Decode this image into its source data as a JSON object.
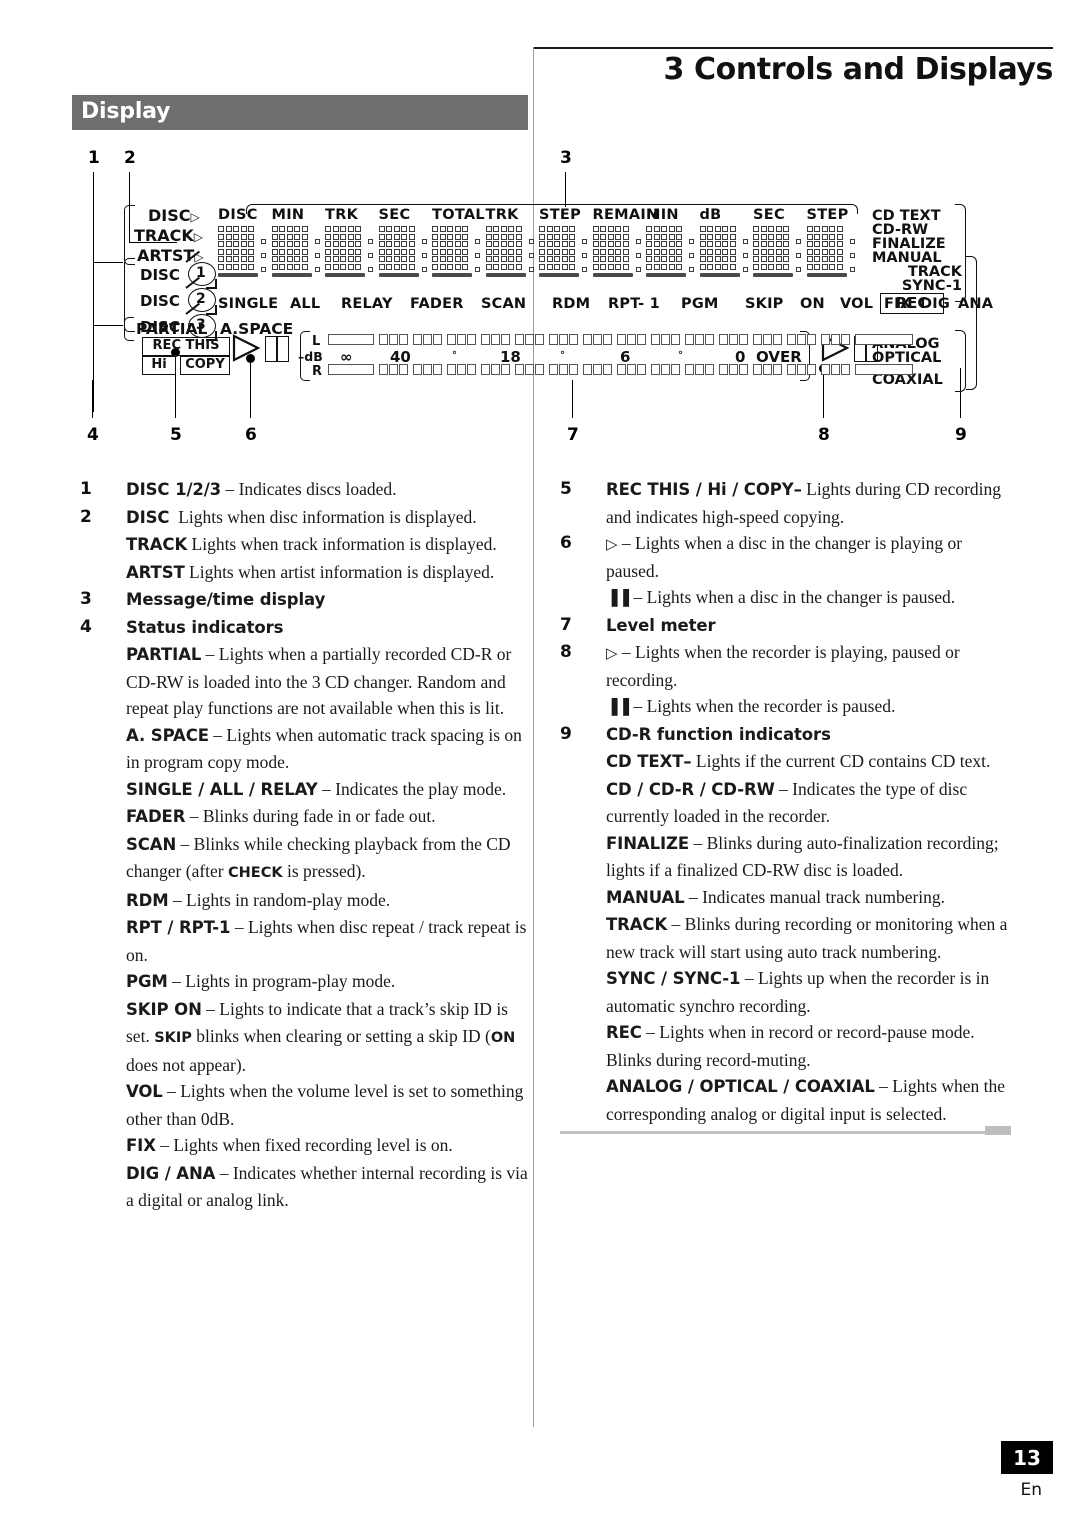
{
  "header": {
    "chapter_title": "3 Controls and Displays",
    "section_title": "Display"
  },
  "footer": {
    "page_number": "13",
    "language": "En"
  },
  "diagram": {
    "callouts": [
      "1",
      "2",
      "3",
      "4",
      "5",
      "6",
      "7",
      "8",
      "9"
    ],
    "left_indicators": [
      "DISC",
      "TRACK",
      "ARTST"
    ],
    "disc_indicators": [
      "DISC",
      "DISC",
      "DISC"
    ],
    "disc_numbers": [
      "1",
      "2",
      "3"
    ],
    "partial": "PARTIAL",
    "a_space": "A.SPACE",
    "rec_this": "REC THIS",
    "hi": "Hi",
    "copy": "COPY",
    "segment_headers": [
      "DISC",
      "MIN",
      "TRK",
      "SEC",
      "TOTAL",
      "TRK",
      "STEP",
      "REMAIN",
      "MIN",
      "dB",
      "SEC",
      "STEP"
    ],
    "mode_row": [
      "SINGLE",
      "ALL",
      "RELAY",
      "FADER",
      "SCAN",
      "RDM",
      "RPT- 1",
      "PGM",
      "SKIP",
      "ON",
      "VOL",
      "FIX",
      "DIG",
      "ANA"
    ],
    "right_indicators": [
      "CD TEXT",
      "CD-RW",
      "FINALIZE",
      "MANUAL",
      "TRACK",
      "SYNC-1"
    ],
    "rec_label": "REC",
    "input_indicators": [
      "ANALOG",
      "OPTICAL",
      "COAXIAL"
    ],
    "meter": {
      "left_label": "L",
      "right_label": "R",
      "db_label": "–dB",
      "scale": [
        "∞",
        "40",
        "°",
        "18",
        "°",
        "6",
        "°",
        "0"
      ],
      "over_label": "OVER"
    }
  },
  "left_column": [
    {
      "num": "1",
      "html": "<b>DISC 1/2/3</b> – Indicates discs loaded."
    },
    {
      "num": "2",
      "html": "<b>DISC</b>&nbsp; Lights when disc information is displayed."
    },
    {
      "num": "",
      "html": "<b>TRACK</b> Lights when track information is displayed."
    },
    {
      "num": "",
      "html": "<b>ARTST</b> Lights when artist information is displayed."
    },
    {
      "num": "3",
      "html": "<b>Message/time display</b>"
    },
    {
      "num": "4",
      "html": "<b>Status indicators</b>"
    },
    {
      "num": "",
      "html": "<b>PARTIAL</b> – Lights when a partially recorded CD-R or CD-RW is loaded into the 3 CD changer. Random and repeat play functions are not available when this is lit."
    },
    {
      "num": "",
      "html": "<b>A. SPACE</b> – Lights when automatic track spacing is on in program copy mode."
    },
    {
      "num": "",
      "html": "<b>SINGLE / ALL / RELAY</b> – Indicates the play mode."
    },
    {
      "num": "",
      "html": "<b>FADER</b> – Blinks during fade in or fade out."
    },
    {
      "num": "",
      "html": "<b>SCAN</b> – Blinks while checking playback from the CD changer (after <span class=\"sm\">CHECK</span> is pressed)."
    },
    {
      "num": "",
      "html": "<b>RDM</b> – Lights in random-play mode."
    },
    {
      "num": "",
      "html": "<b>RPT / RPT-1</b> – Lights when disc repeat / track repeat is on."
    },
    {
      "num": "",
      "html": "<b>PGM</b> – Lights in program-play mode."
    },
    {
      "num": "",
      "html": "<b>SKIP ON</b> – Lights to indicate that a track’s skip ID is set. <span class=\"sm\">SKIP</span> blinks when clearing or setting a skip ID (<span class=\"sm\">ON</span> does not appear)."
    },
    {
      "num": "",
      "html": "<b>VOL</b> – Lights when the volume level is set to something other than 0dB."
    },
    {
      "num": "",
      "html": "<b>FIX</b> – Lights when fixed recording level is on."
    },
    {
      "num": "",
      "html": "<b>DIG / ANA</b> – Indicates whether internal recording is via a digital or analog link."
    }
  ],
  "right_column": [
    {
      "num": "5",
      "html": "<b>REC THIS / Hi / COPY</b><b>–</b> Lights during CD recording and indicates high-speed copying."
    },
    {
      "num": "6",
      "html": "<span class=\"gl\">▷</span> – Lights when a disc in the changer is playing or paused."
    },
    {
      "num": "",
      "html": "<span class=\"gl\">▐▐</span> – Lights when a disc in the changer is paused."
    },
    {
      "num": "7",
      "html": "<b>Level meter</b>"
    },
    {
      "num": "8",
      "html": "<span class=\"gl\">▷</span> – Lights when the recorder is playing, paused or recording."
    },
    {
      "num": "",
      "html": "<span class=\"gl\">▐▐</span> – Lights when the recorder is paused."
    },
    {
      "num": "9",
      "html": "<b>CD-R function indicators</b>"
    },
    {
      "num": "",
      "html": "<b>CD TEXT</b><b>–</b> Lights if the current CD contains CD text."
    },
    {
      "num": "",
      "html": "<b>CD / CD-R / CD-RW</b> – Indicates the type of disc currently loaded in the recorder."
    },
    {
      "num": "",
      "html": "<b>FINALIZE</b> – Blinks during auto-finalization recording; lights if a finalized CD-RW disc is loaded."
    },
    {
      "num": "",
      "html": "<b>MANUAL</b> – Indicates manual track numbering."
    },
    {
      "num": "",
      "html": "<b>TRACK</b> – Blinks during recording or monitoring when a new track will start using auto track numbering."
    },
    {
      "num": "",
      "html": "<b>SYNC / SYNC-1</b> – Lights up when the recorder is in automatic synchro recording."
    },
    {
      "num": "",
      "html": "<b>REC</b> – Lights when in record or record-pause mode. Blinks during record-muting."
    },
    {
      "num": "",
      "html": "<b>ANALOG / OPTICAL / COAXIAL</b> – Lights when the corresponding analog or digital input is selected."
    }
  ]
}
